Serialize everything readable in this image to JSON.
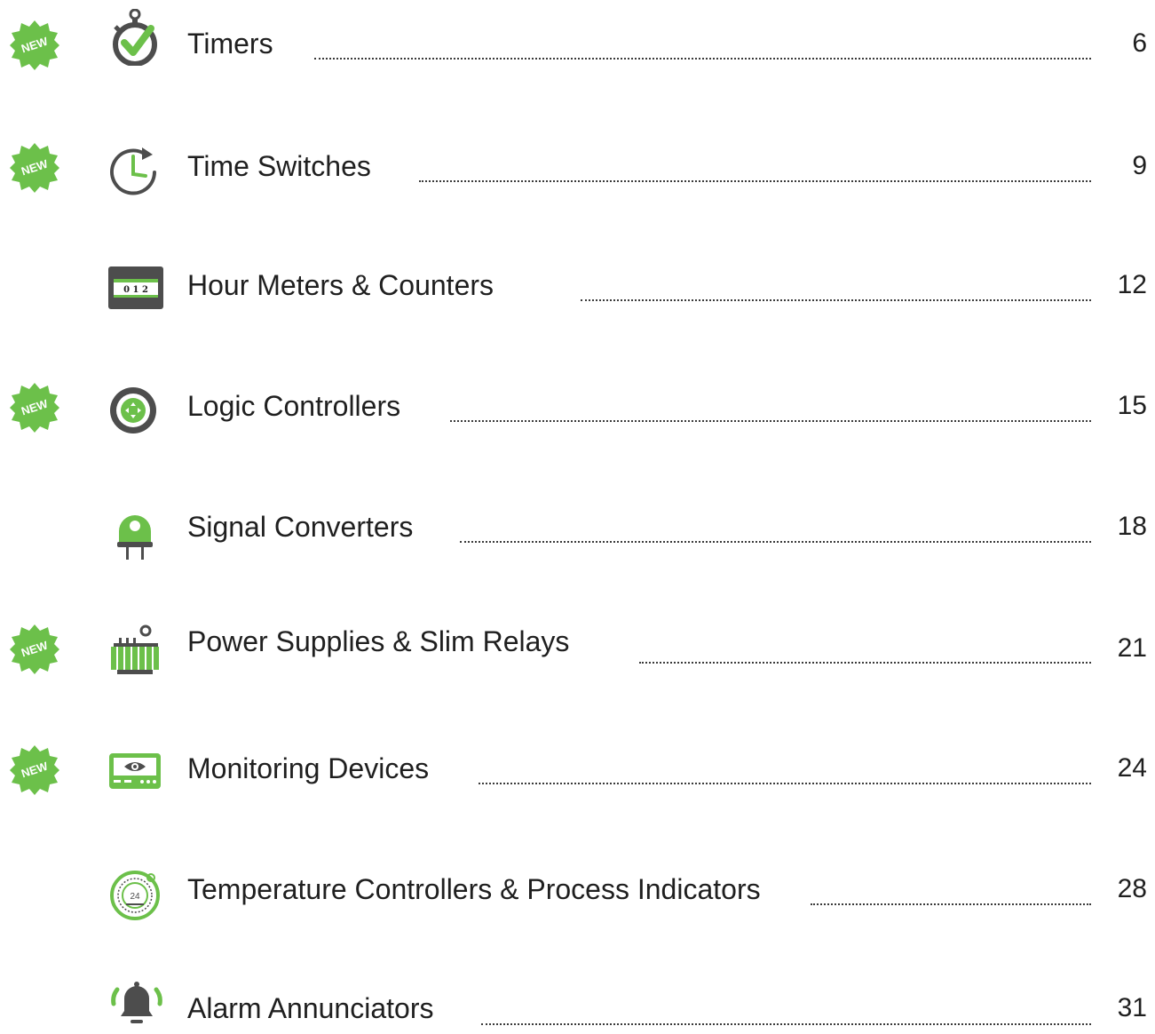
{
  "new_badge_label": "NEW",
  "colors": {
    "accent": "#6cc04a",
    "icon_dark": "#4d4d4d",
    "text": "#1f1f1f"
  },
  "items": [
    {
      "title": "Timers",
      "page": "6",
      "new": true,
      "icon": "stopwatch-check-icon"
    },
    {
      "title": "Time Switches",
      "page": "9",
      "new": true,
      "icon": "clock-refresh-icon"
    },
    {
      "title": "Hour Meters & Counters",
      "page": "12",
      "new": false,
      "icon": "counter-display-icon",
      "icon_text": "0 1 2"
    },
    {
      "title": "Logic Controllers",
      "page": "15",
      "new": true,
      "icon": "controller-dial-icon"
    },
    {
      "title": "Signal Converters",
      "page": "18",
      "new": false,
      "icon": "signal-plug-icon"
    },
    {
      "title": "Power Supplies & Slim Relays",
      "page": "21",
      "new": true,
      "icon": "power-transformer-icon"
    },
    {
      "title": "Monitoring Devices",
      "page": "24",
      "new": true,
      "icon": "monitor-eye-icon"
    },
    {
      "title": "Temperature Controllers & Process Indicators",
      "page": "28",
      "new": false,
      "icon": "temperature-gauge-icon",
      "icon_text": "24"
    },
    {
      "title": "Alarm Annunciators",
      "page": "31",
      "new": false,
      "icon": "alarm-bell-icon"
    }
  ]
}
